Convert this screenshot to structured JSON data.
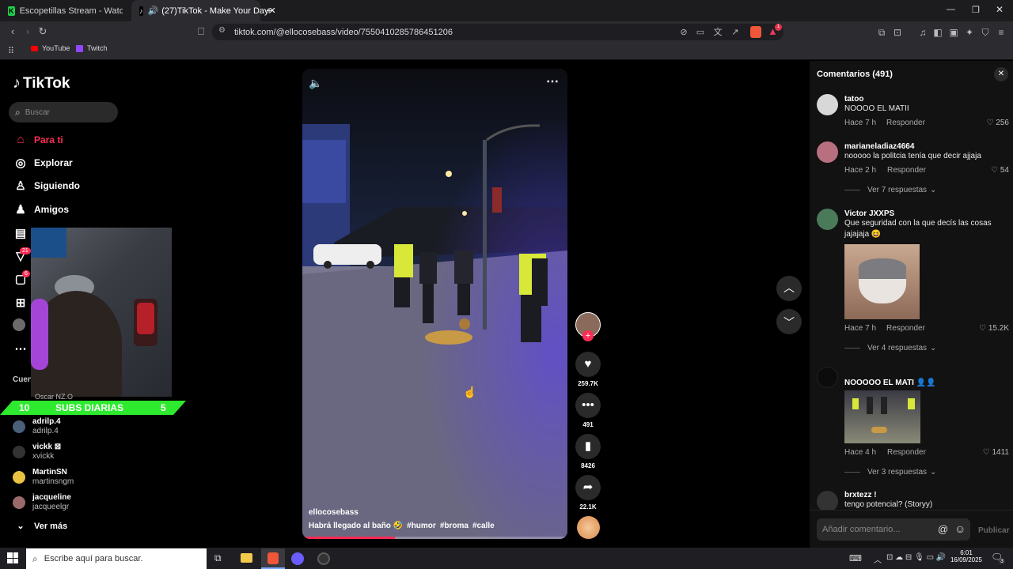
{
  "browser": {
    "tabs": [
      {
        "label": "Escopetillas Stream - Watch Live on I"
      },
      {
        "label": "(27)TikTok - Make Your Day"
      }
    ],
    "new_tab": "+",
    "url": "tiktok.com/@ellocosebass/video/7550410285786451206",
    "bookmarks": [
      {
        "label": "YouTube"
      },
      {
        "label": "Twitch"
      }
    ],
    "shield_badge": "1"
  },
  "sidebar": {
    "logo": "TikTok",
    "search_placeholder": "Buscar",
    "nav": [
      {
        "label": "Para ti"
      },
      {
        "label": "Explorar"
      },
      {
        "label": "Siguiendo"
      },
      {
        "label": "Amigos"
      }
    ],
    "badges": {
      "activity": "21",
      "messages": "6"
    },
    "following_heading": "Cuen",
    "accounts": [
      {
        "name": "adrilp.4",
        "handle": "adrilp.4"
      },
      {
        "name": "vickk ⊠",
        "handle": "xvickk"
      },
      {
        "name": "MartinSN",
        "handle": "martinsngm"
      },
      {
        "name": "jacqueline",
        "handle": "jacqueelgr"
      }
    ],
    "see_more": "Ver más",
    "stream_banner": {
      "left": "10",
      "middle": "SUBS DIARIAS",
      "right": "5"
    },
    "hidden_name": "Oscar NZ.O"
  },
  "video": {
    "author": "ellocosebass",
    "caption": "Habrá llegado al baño 🤣",
    "hashtags": [
      "#humor",
      "#broma",
      "#calle"
    ],
    "progress": 0.35
  },
  "actions": {
    "likes": "259.7K",
    "comments": "491",
    "saves": "8426",
    "shares": "22.1K"
  },
  "comments": {
    "title": "Comentarios (491)",
    "items": [
      {
        "user": "tatoo",
        "text": "NOOOO EL MATII",
        "time": "Hace 7 h",
        "reply": "Responder",
        "likes": "256"
      },
      {
        "user": "marianeladiaz4664",
        "text": "nooooo la politcia tenía que decir ajjaja",
        "time": "Hace 2 h",
        "reply": "Responder",
        "likes": "54",
        "replies": "Ver 7 respuestas"
      },
      {
        "user": "Victor JXXPS",
        "text": "Que seguridad con la que decís las cosas jajajaja 😆",
        "time": "Hace 7 h",
        "reply": "Responder",
        "likes": "15.2K",
        "replies": "Ver 4 respuestas"
      },
      {
        "user": "NOOOOO EL MATI 👤👤",
        "text": "",
        "time": "Hace 4 h",
        "reply": "Responder",
        "likes": "1411",
        "replies": "Ver 3 respuestas"
      },
      {
        "user": "brxtezz !",
        "text": "tengo potencial? (Storyy)"
      }
    ],
    "input_placeholder": "Añadir comentario...",
    "publish": "Publicar"
  },
  "taskbar": {
    "search_placeholder": "Escribe aquí para buscar.",
    "time": "6:01",
    "date": "16/09/2025",
    "notif": "3"
  }
}
